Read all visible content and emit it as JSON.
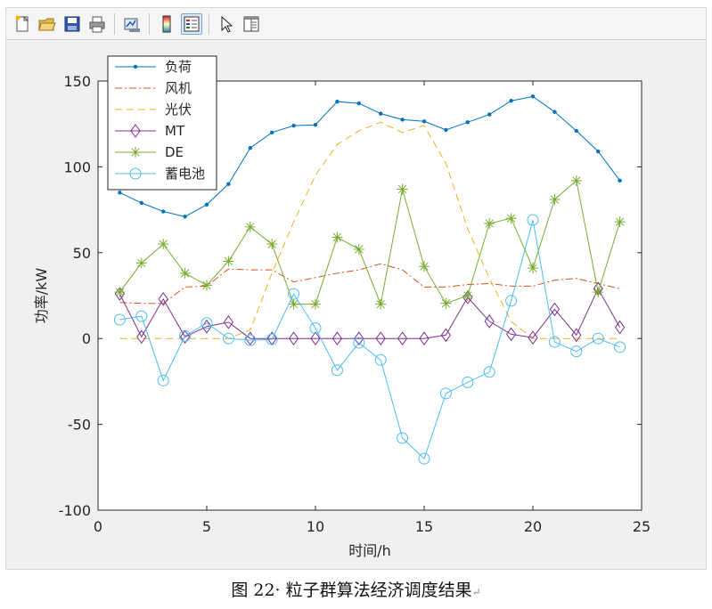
{
  "toolbar": {
    "buttons": [
      {
        "name": "new-figure-icon"
      },
      {
        "name": "open-file-icon"
      },
      {
        "name": "save-icon"
      },
      {
        "name": "print-icon"
      },
      {
        "sep": true
      },
      {
        "name": "link-plot-icon"
      },
      {
        "sep": true
      },
      {
        "name": "colorbar-icon"
      },
      {
        "name": "legend-icon",
        "active": true
      },
      {
        "sep": true
      },
      {
        "name": "pointer-icon"
      },
      {
        "name": "property-editor-icon"
      }
    ]
  },
  "caption": {
    "text": "图 22· 粒子群算法经济调度结果",
    "mark": "↵"
  },
  "chart_data": {
    "type": "line",
    "xlabel": "时间/h",
    "ylabel": "功率/kW",
    "xlim": [
      0,
      25
    ],
    "ylim": [
      -100,
      150
    ],
    "xticks": [
      0,
      5,
      10,
      15,
      20,
      25
    ],
    "yticks": [
      -100,
      -50,
      0,
      50,
      100,
      150
    ],
    "grid": false,
    "legend_position": "top-left",
    "x": [
      1,
      2,
      3,
      4,
      5,
      6,
      7,
      8,
      9,
      10,
      11,
      12,
      13,
      14,
      15,
      16,
      17,
      18,
      19,
      20,
      21,
      22,
      23,
      24
    ],
    "series": [
      {
        "name": "负荷",
        "color": "#0072bd",
        "style": "solid",
        "marker": "dot",
        "values": [
          85,
          79,
          74,
          71,
          78,
          90,
          111,
          120,
          124,
          124.5,
          138,
          137,
          131,
          127.5,
          126.5,
          121.5,
          126,
          130.5,
          138.5,
          141,
          132,
          121,
          109,
          92
        ]
      },
      {
        "name": "风机",
        "color": "#d95319",
        "style": "dashdot",
        "marker": "none",
        "values": [
          21,
          20.5,
          20.5,
          30,
          30.5,
          40.5,
          40,
          40,
          33,
          35.5,
          38,
          40,
          43.5,
          40,
          30,
          30,
          31.5,
          32,
          30.5,
          30.5,
          34,
          35,
          32,
          29
        ]
      },
      {
        "name": "光伏",
        "color": "#edb120",
        "style": "dashed",
        "marker": "none",
        "values": [
          0,
          0,
          0,
          0,
          0,
          0,
          5,
          38,
          68,
          95,
          113,
          121,
          126,
          120,
          124,
          102,
          64,
          35,
          10,
          0,
          0,
          0,
          0,
          0
        ]
      },
      {
        "name": "MT",
        "color": "#7e2f8e",
        "style": "solid",
        "marker": "diamond",
        "values": [
          26,
          1,
          23,
          1,
          7,
          9.5,
          0,
          0,
          0,
          0,
          0,
          0,
          0,
          0,
          0,
          2,
          24,
          10,
          2.5,
          0.5,
          17,
          2,
          29,
          6.5
        ]
      },
      {
        "name": "DE",
        "color": "#77ac30",
        "style": "solid",
        "marker": "star",
        "values": [
          27,
          44,
          55,
          38,
          31,
          45,
          65,
          55,
          20,
          20,
          59,
          52,
          20,
          87,
          42,
          20.5,
          25,
          67,
          70,
          41,
          81,
          92,
          27,
          68
        ]
      },
      {
        "name": "蓄电池",
        "color": "#4dbeee",
        "style": "solid",
        "marker": "circle",
        "values": [
          11,
          13,
          -24.5,
          1.5,
          9,
          0,
          -1,
          -0.5,
          26,
          6,
          -18.5,
          -2.5,
          -12.5,
          -58,
          -70,
          -32,
          -25.5,
          -19.5,
          22,
          69,
          -2,
          -7.5,
          0,
          -5
        ]
      }
    ]
  }
}
